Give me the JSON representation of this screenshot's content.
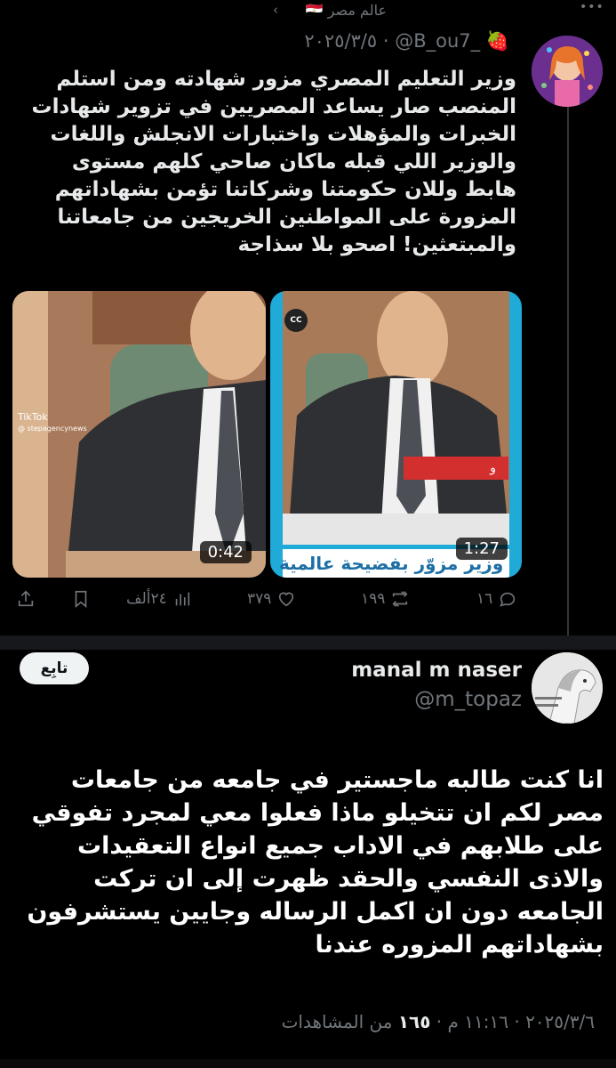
{
  "community": {
    "name": "عالم مصر",
    "flag": "🇪🇬",
    "chevron": "‹",
    "more": "•••"
  },
  "post": {
    "emoji": "🍓",
    "handle": "@B_ou7_",
    "date": "٢٠٢٥/٣/٥",
    "separator": " · ",
    "text": "وزير التعليم المصري مزور شهادته ومن استلم المنصب صار يساعد المصريين في تزوير شهادات الخبرات والمؤهلات واختبارات الانجلش واللغات والوزير اللي قبله ماكان صاحي كلهم مستوى هابط وللان حكومتنا وشركاتنا تؤمن بشهاداتهم المزورة على المواطنين الخريجين من جامعاتنا والمبتعثين! اصحو بلا سذاجة",
    "media": [
      {
        "duration": "0:42",
        "watermark": "TikTok",
        "watermark_handle": "@ stepagencynews"
      },
      {
        "duration": "1:27",
        "badge": "CC",
        "bar_text": "و",
        "caption": "وزير مزوّر بفضيحة عالمية"
      }
    ],
    "actions": {
      "replies": "١٦",
      "reposts": "١٩٩",
      "likes": "٣٧٩",
      "views": "٢٤ألف"
    }
  },
  "reply": {
    "name": "manal m naser",
    "handle": "@m_topaz",
    "follow_label": "تابِع",
    "text": "انا كنت طالبه ماجستير في جامعه من جامعات مصر لكم ان تتخيلو ماذا فعلوا معي لمجرد تفوقي على طلابهم في الاداب جميع انواع التعقيدات والاذى النفسي والحقد ظهرت إلى ان تركت الجامعه دون ان اكمل الرساله وجايين يستشرفون بشهاداتهم المزوره عندنا",
    "date": "٢٠٢٥/٣/٦",
    "time": "١١:١٦ م",
    "views_count": "١٦٥",
    "views_label": "من المشاهدات",
    "dot": " · "
  },
  "colors": {
    "background": "#000000",
    "text": "#e7e9ea",
    "muted": "#71767b",
    "follow_bg": "#eff3f4"
  }
}
